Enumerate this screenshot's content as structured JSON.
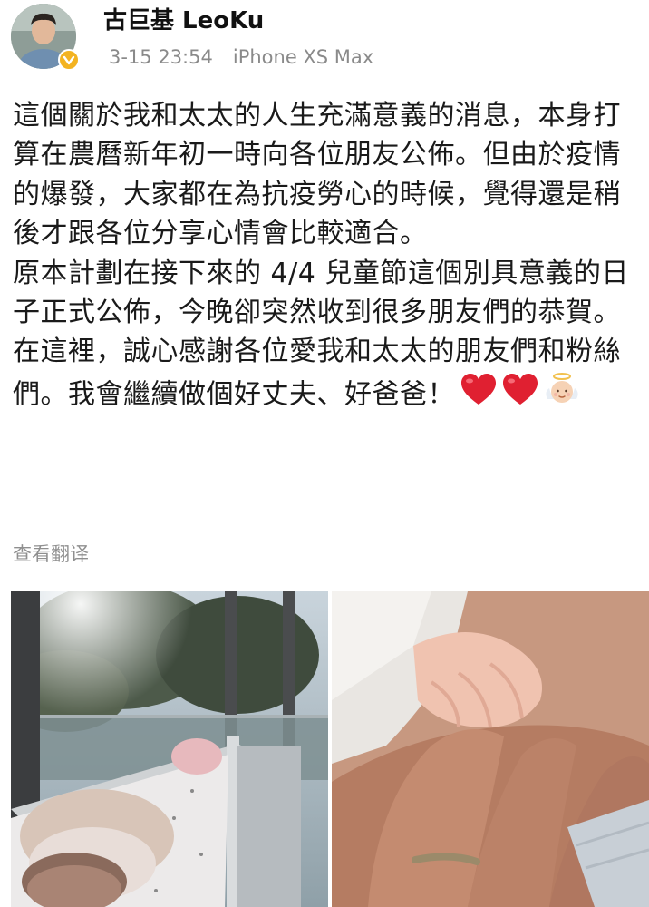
{
  "post": {
    "author": {
      "name": "古巨基 LeoKu",
      "verified": true
    },
    "timestamp": "3-15 23:54",
    "device": "iPhone XS Max",
    "paragraph_1": "這個關於我和太太的人生充滿意義的消息，本身打算在農曆新年初一時向各位朋友公佈。但由於疫情的爆發，大家都在為抗疫勞心的時候，覺得還是稍後才跟各位分享心情會比較適合。",
    "paragraph_2": "原本計劃在接下來的 4/4 兒童節這個別具意義的日子正式公佈，今晚卻突然收到很多朋友們的恭賀。在這裡，誠心感謝各位愛我和太太的朋友們和粉絲們。我會繼續做個好丈夫、好爸爸！",
    "emojis": [
      "red-heart",
      "red-heart",
      "baby-angel"
    ],
    "translate_label": "查看翻译",
    "images": [
      {
        "name": "baby-in-crib-photo"
      },
      {
        "name": "baby-hand-holding-finger-photo"
      }
    ]
  },
  "colors": {
    "verified_badge": "#f3b321",
    "meta_text": "#8a8a8a",
    "heart": "#e02031"
  }
}
